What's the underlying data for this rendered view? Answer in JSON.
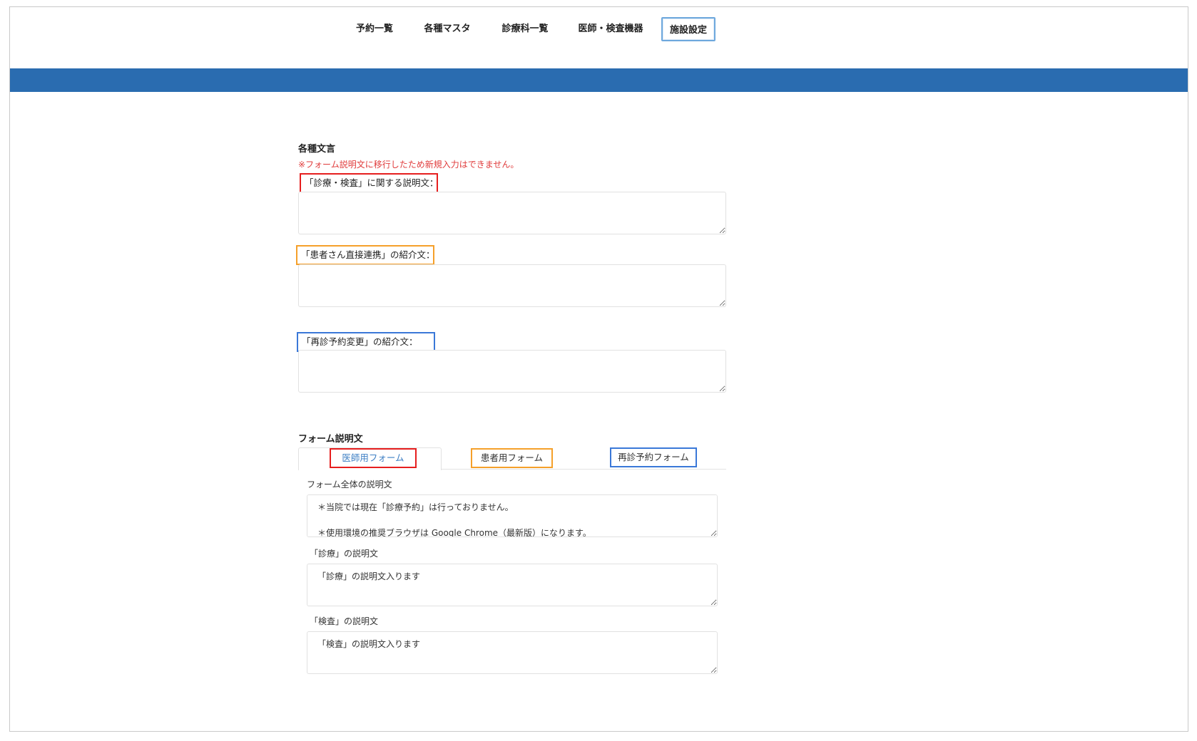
{
  "nav": {
    "items": [
      {
        "label": "予約一覧"
      },
      {
        "label": "各種マスタ"
      },
      {
        "label": "診療科一覧"
      },
      {
        "label": "医師・検査機器"
      },
      {
        "label": "施設設定"
      }
    ],
    "active": "施設設定"
  },
  "colors": {
    "band": "#2a6cb0",
    "notice": "#e03b3b",
    "outline_red": "#e61e1e",
    "outline_orange": "#f5a02a",
    "outline_blue": "#3a78d8"
  },
  "messages": {
    "heading": "各種文言",
    "notice": "※フォーム説明文に移行したため新規入力はできません。",
    "fields": [
      {
        "label": "「診療・検査」に関する説明文：",
        "value": ""
      },
      {
        "label": "「患者さん直接連携」の紹介文：",
        "value": ""
      },
      {
        "label": "「再診予約変更」の紹介文：",
        "value": ""
      }
    ]
  },
  "form_desc": {
    "heading": "フォーム説明文",
    "tabs": [
      {
        "label": "医師用フォーム",
        "active": true
      },
      {
        "label": "患者用フォーム",
        "active": false
      },
      {
        "label": "再診予約フォーム",
        "active": false
      }
    ],
    "fields": [
      {
        "label": "フォーム全体の説明文",
        "value": "＊当院では現在「診療予約」は行っておりません。\n\n＊使用環境の推奨ブラウザは Google Chrome（最新版）になります。"
      },
      {
        "label": "「診療」の説明文",
        "value": "「診療」の説明文入ります"
      },
      {
        "label": "「検査」の説明文",
        "value": "「検査」の説明文入ります"
      }
    ]
  }
}
